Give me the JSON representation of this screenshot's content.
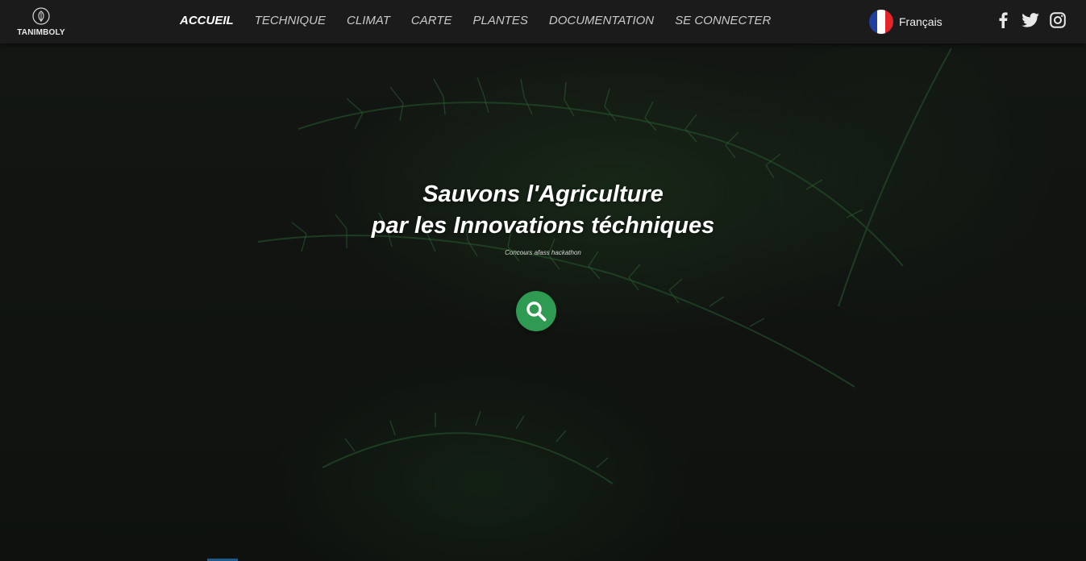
{
  "brand": {
    "name": "TANIMBOLY",
    "logo_icon": "leaf-badge-icon"
  },
  "nav": {
    "items": [
      {
        "label": "ACCUEIL",
        "active": true
      },
      {
        "label": "TECHNIQUE",
        "active": false
      },
      {
        "label": "CLIMAT",
        "active": false
      },
      {
        "label": "CARTE",
        "active": false
      },
      {
        "label": "PLANTES",
        "active": false
      },
      {
        "label": "DOCUMENTATION",
        "active": false
      },
      {
        "label": "SE CONNECTER",
        "active": false
      }
    ]
  },
  "language": {
    "label": "Français",
    "flag_icon": "france-flag-icon",
    "flag_colors": [
      "#1f3fa0",
      "#ffffff",
      "#e3242b"
    ]
  },
  "socials": [
    {
      "name": "facebook-icon"
    },
    {
      "name": "twitter-icon"
    },
    {
      "name": "instagram-icon"
    }
  ],
  "hero": {
    "headline_line1": "Sauvons l'Agriculture",
    "headline_line2": "par les Innovations téchniques",
    "tagline": "Concours afass hackathon",
    "search_icon": "search-icon"
  },
  "colors": {
    "accent": "#2e9a52",
    "topbar": "#1c1c1c",
    "background": "#141714"
  }
}
